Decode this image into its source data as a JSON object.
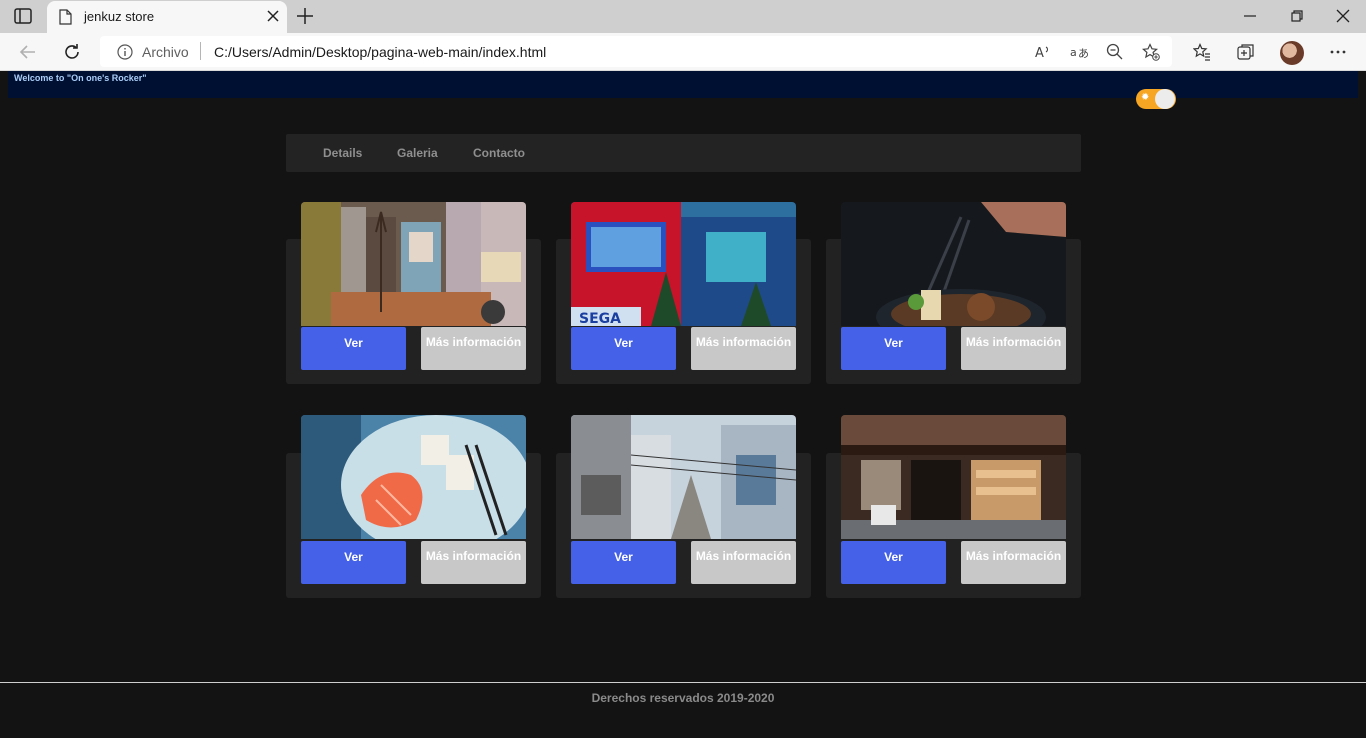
{
  "browser": {
    "tab_title": "jenkuz store",
    "url_scheme": "Archivo",
    "url": "C:/Users/Admin/Desktop/pagina-web-main/index.html",
    "icons": [
      "tab-actions-icon",
      "page-icon",
      "close-tab-icon",
      "new-tab-icon",
      "minimize-icon",
      "restore-icon",
      "close-window-icon",
      "back-icon",
      "refresh-icon",
      "info-icon",
      "read-aloud-icon",
      "translate-icon",
      "zoom-out-icon",
      "add-favorite-icon",
      "favorites-icon",
      "collections-icon",
      "profile-avatar",
      "more-icon"
    ]
  },
  "page": {
    "welcome": "Welcome to \"On one's Rocker\"",
    "theme_toggle_icon": "sun-icon",
    "accent": "#f6a623",
    "nav": {
      "details": "Details",
      "galeria": "Galeria",
      "contacto": "Contacto"
    },
    "cards": [
      {
        "image": "akihabara-street-signs",
        "ver": "Ver",
        "mas": "Más información"
      },
      {
        "image": "sega-building-night",
        "ver": "Ver",
        "mas": "Más información"
      },
      {
        "image": "noodles-chopsticks",
        "ver": "Ver",
        "mas": "Más información"
      },
      {
        "image": "salmon-sashimi-plate",
        "ver": "Ver",
        "mas": "Más información"
      },
      {
        "image": "narrow-city-alley",
        "ver": "Ver",
        "mas": "Más información"
      },
      {
        "image": "traditional-shopfront",
        "ver": "Ver",
        "mas": "Más información"
      }
    ],
    "button_color": "#4461e8",
    "footer": "Derechos reservados 2019-2020"
  }
}
